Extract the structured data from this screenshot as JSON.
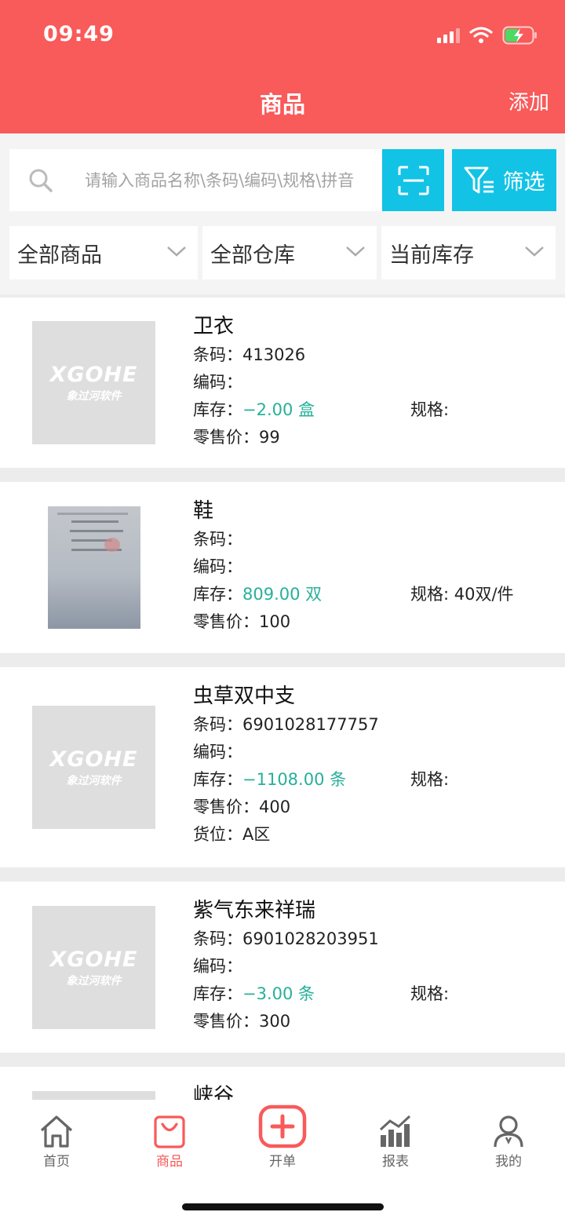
{
  "status_bar": {
    "time": "09:49"
  },
  "header": {
    "title": "商品",
    "add_label": "添加",
    "bg_color": "#f95a5a"
  },
  "search": {
    "placeholder": "请输入商品名称\\条码\\编码\\规格\\拼音",
    "filter_label": "筛选",
    "accent_color": "#12c3e6"
  },
  "filters": [
    {
      "label": "全部商品"
    },
    {
      "label": "全部仓库"
    },
    {
      "label": "当前库存"
    }
  ],
  "labels": {
    "barcode": "条码：",
    "code": "编码：",
    "stock": "库存：",
    "spec": "规格:",
    "price": "零售价：",
    "location": "货位："
  },
  "thumb_placeholder": {
    "brand": "XGOHE",
    "sub": "象过河软件"
  },
  "products": [
    {
      "name": "卫衣",
      "barcode": "413026",
      "code": "",
      "stock": "−2.00 盒",
      "spec": "",
      "price": "99",
      "image": "placeholder"
    },
    {
      "name": "鞋",
      "barcode": "",
      "code": "",
      "stock": "809.00 双",
      "spec": "40双/件",
      "price": "100",
      "image": "photo"
    },
    {
      "name": "虫草双中支",
      "barcode": "6901028177757",
      "code": "",
      "stock": "−1108.00 条",
      "spec": "",
      "price": "400",
      "location": "A区",
      "image": "placeholder"
    },
    {
      "name": "紫气东来祥瑞",
      "barcode": "6901028203951",
      "code": "",
      "stock": "−3.00 条",
      "spec": "",
      "price": "300",
      "image": "placeholder"
    },
    {
      "name": "峡谷",
      "image": "placeholder"
    }
  ],
  "tabbar": [
    {
      "label": "首页",
      "icon": "home-icon",
      "active": false
    },
    {
      "label": "商品",
      "icon": "bag-icon",
      "active": true
    },
    {
      "label": "开单",
      "icon": "plus-square-icon",
      "active": false
    },
    {
      "label": "报表",
      "icon": "bar-chart-icon",
      "active": false
    },
    {
      "label": "我的",
      "icon": "user-icon",
      "active": false
    }
  ],
  "colors": {
    "stock_value": "#27b09a",
    "active_tab": "#f95a5a"
  }
}
